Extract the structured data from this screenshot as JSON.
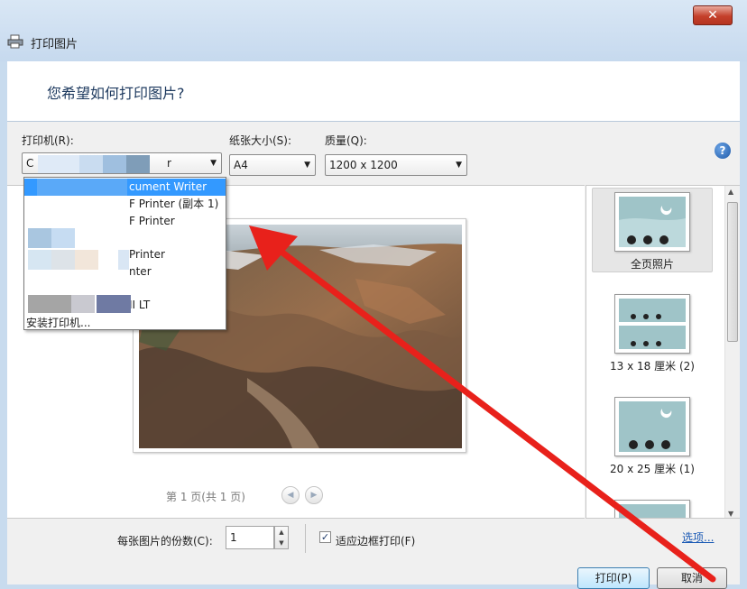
{
  "window": {
    "title": "打印图片",
    "close_glyph": "✕"
  },
  "header": {
    "question": "您希望如何打印图片?"
  },
  "printer": {
    "label": "打印机(R):",
    "selected_fragment": "C",
    "selected_suffix": "r",
    "install_link": "安装打印机...",
    "options": [
      {
        "label": "cument Writer",
        "highlighted": true
      },
      {
        "label": "F Printer (副本 1)",
        "highlighted": false
      },
      {
        "label": "F Printer",
        "highlighted": false
      },
      {
        "label": "",
        "highlighted": false
      },
      {
        "label": "Printer",
        "highlighted": false
      },
      {
        "label": "nter",
        "highlighted": false
      },
      {
        "label": "",
        "highlighted": false
      },
      {
        "label": "II LT",
        "highlighted": false
      }
    ]
  },
  "paper_size": {
    "label": "纸张大小(S):",
    "value": "A4"
  },
  "quality": {
    "label": "质量(Q):",
    "value": "1200 x 1200"
  },
  "help": {
    "glyph": "?"
  },
  "preview": {
    "pager_text": "第 1 页(共 1 页)",
    "prev_glyph": "◀",
    "next_glyph": "▶"
  },
  "layouts": [
    {
      "label": "全页照片",
      "selected": true
    },
    {
      "label": "13 x 18 厘米 (2)",
      "selected": false
    },
    {
      "label": "20 x 25 厘米 (1)",
      "selected": false
    },
    {
      "label": "",
      "selected": false
    }
  ],
  "bottom": {
    "copies_label": "每张图片的份数(C):",
    "copies_value": "1",
    "spin_up": "▲",
    "spin_down": "▼",
    "fit_label": "适应边框打印(F)",
    "fit_checked": true,
    "check_glyph": "✓",
    "options_link": "选项..."
  },
  "buttons": {
    "print": "打印(P)",
    "cancel": "取消"
  },
  "colors": {
    "annotation_arrow": "#e8211b",
    "highlight": "#3399ff",
    "link": "#1c5bb5"
  }
}
